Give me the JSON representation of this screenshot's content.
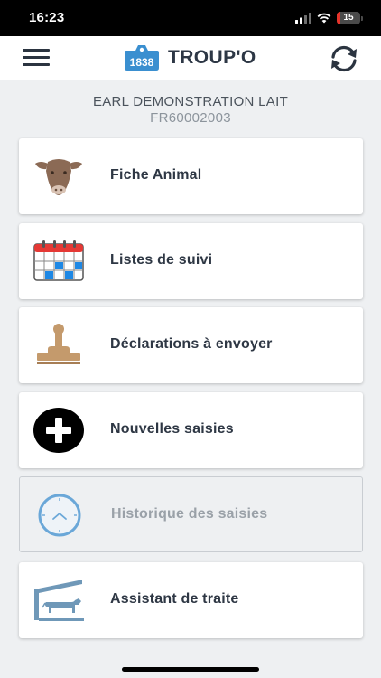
{
  "status_bar": {
    "time": "16:23",
    "battery": "15",
    "battery_level": 0.15
  },
  "header": {
    "title": "TROUP'O",
    "logo_text": "1838"
  },
  "farm": {
    "name": "EARL DEMONSTRATION LAIT",
    "id": "FR60002003"
  },
  "menu": [
    {
      "label": "Fiche Animal",
      "icon": "cow-head-icon",
      "enabled": true
    },
    {
      "label": "Listes de suivi",
      "icon": "calendar-icon",
      "enabled": true
    },
    {
      "label": "Déclarations à envoyer",
      "icon": "stamp-icon",
      "enabled": true
    },
    {
      "label": "Nouvelles saisies",
      "icon": "add-circle-icon",
      "enabled": true
    },
    {
      "label": "Historique des saisies",
      "icon": "clock-icon",
      "enabled": false
    },
    {
      "label": "Assistant de traite",
      "icon": "milking-barn-icon",
      "enabled": true
    }
  ],
  "colors": {
    "background": "#eef0f2",
    "logo_blue": "#3a8fd0",
    "cow_brown": "#8b6a55",
    "stamp_tan": "#c49a6c",
    "calendar_red": "#e53935",
    "calendar_blue": "#1e88e5",
    "history_blue": "#6aa7d8",
    "barn_blue": "#6f98b8"
  }
}
